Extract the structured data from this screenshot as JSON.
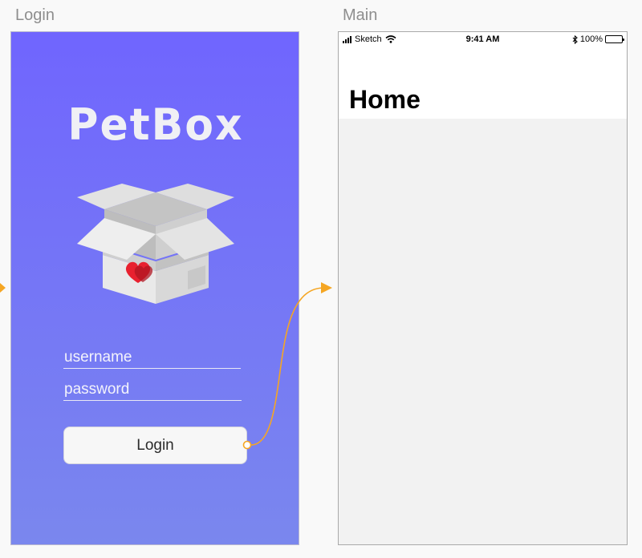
{
  "artboards": {
    "login": {
      "title": "Login"
    },
    "main": {
      "title": "Main"
    }
  },
  "login_screen": {
    "logo_text": "PetBox",
    "username": {
      "placeholder": "username"
    },
    "password": {
      "placeholder": "password"
    },
    "login_button": {
      "label": "Login"
    }
  },
  "main_screen": {
    "status_bar": {
      "carrier": "Sketch",
      "time": "9:41 AM",
      "battery": "100%"
    },
    "title": "Home"
  },
  "colors": {
    "gradient_top": "#7065fe",
    "gradient_bottom": "#7a87ee",
    "prototype_link": "#f5a623",
    "heart": "#e8212f"
  },
  "icons": [
    "open-box-icon",
    "heart-icon",
    "wifi-icon",
    "bluetooth-icon",
    "battery-icon",
    "signal-icon"
  ]
}
